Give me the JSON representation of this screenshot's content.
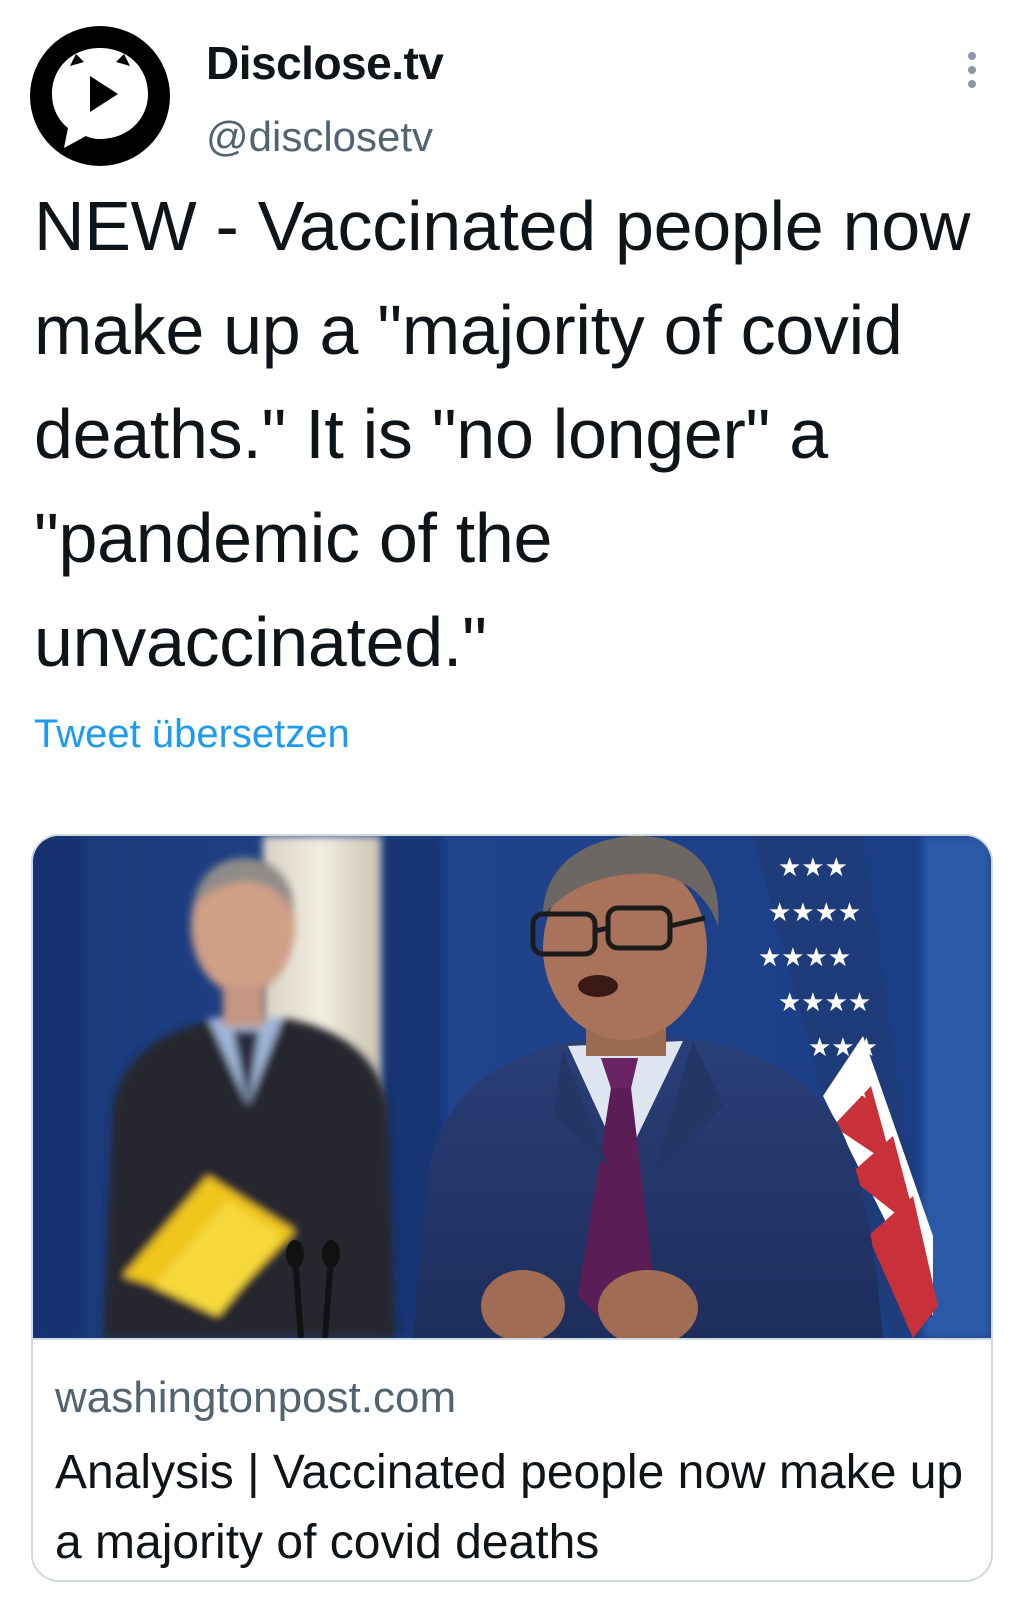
{
  "tweet": {
    "author_name": "Disclose.tv",
    "author_handle": "@disclosetv",
    "avatar_icon": "disclose-tv-logo-icon",
    "more_icon": "more-vertical-icon",
    "text": "NEW - Vaccinated people now make up a \"majority of covid deaths.\" It is \"no longer\" a \"pandemic of the unvaccinated.\"",
    "translate_label": "Tweet übersetzen"
  },
  "link_card": {
    "domain": "washingtonpost.com",
    "title": "Analysis | Vaccinated people now make up a majority of covid deaths"
  },
  "colors": {
    "link_blue": "#1d9bf0",
    "secondary_text": "#536471",
    "primary_text": "#0f1419",
    "card_border": "#cfd9de"
  }
}
